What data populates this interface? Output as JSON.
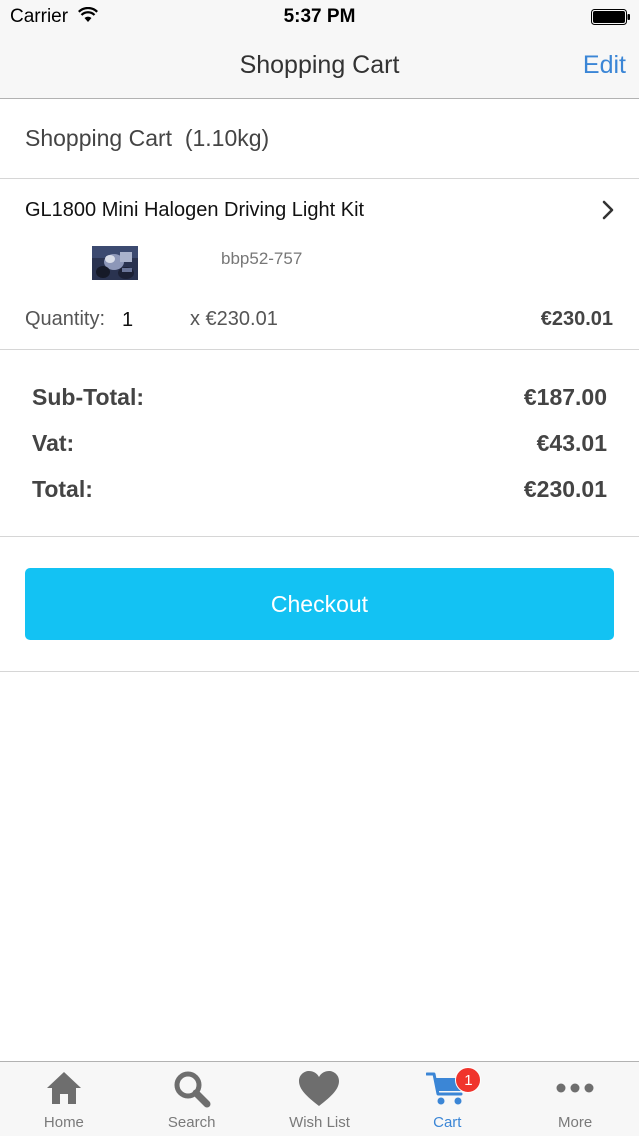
{
  "status_bar": {
    "carrier": "Carrier",
    "time": "5:37 PM"
  },
  "nav": {
    "title": "Shopping Cart",
    "edit_label": "Edit"
  },
  "cart": {
    "header": "Shopping Cart  (1.10kg)",
    "items": [
      {
        "title": "GL1800 Mini Halogen Driving Light Kit",
        "sku": "bbp52-757",
        "quantity_label": "Quantity:",
        "quantity": "1",
        "unit_price": "x €230.01",
        "line_total": "€230.01"
      }
    ],
    "totals": {
      "subtotal_label": "Sub-Total:",
      "subtotal_value": "€187.00",
      "vat_label": "Vat:",
      "vat_value": "€43.01",
      "total_label": "Total:",
      "total_value": "€230.01"
    },
    "checkout_label": "Checkout"
  },
  "tab_bar": {
    "tabs": [
      {
        "label": "Home",
        "icon": "home-icon"
      },
      {
        "label": "Search",
        "icon": "search-icon"
      },
      {
        "label": "Wish List",
        "icon": "heart-icon"
      },
      {
        "label": "Cart",
        "icon": "cart-icon",
        "badge": "1",
        "active": true
      },
      {
        "label": "More",
        "icon": "more-icon"
      }
    ]
  },
  "colors": {
    "accent": "#3b86d6",
    "checkout_button": "#13c2f3",
    "badge": "#f0342c"
  }
}
